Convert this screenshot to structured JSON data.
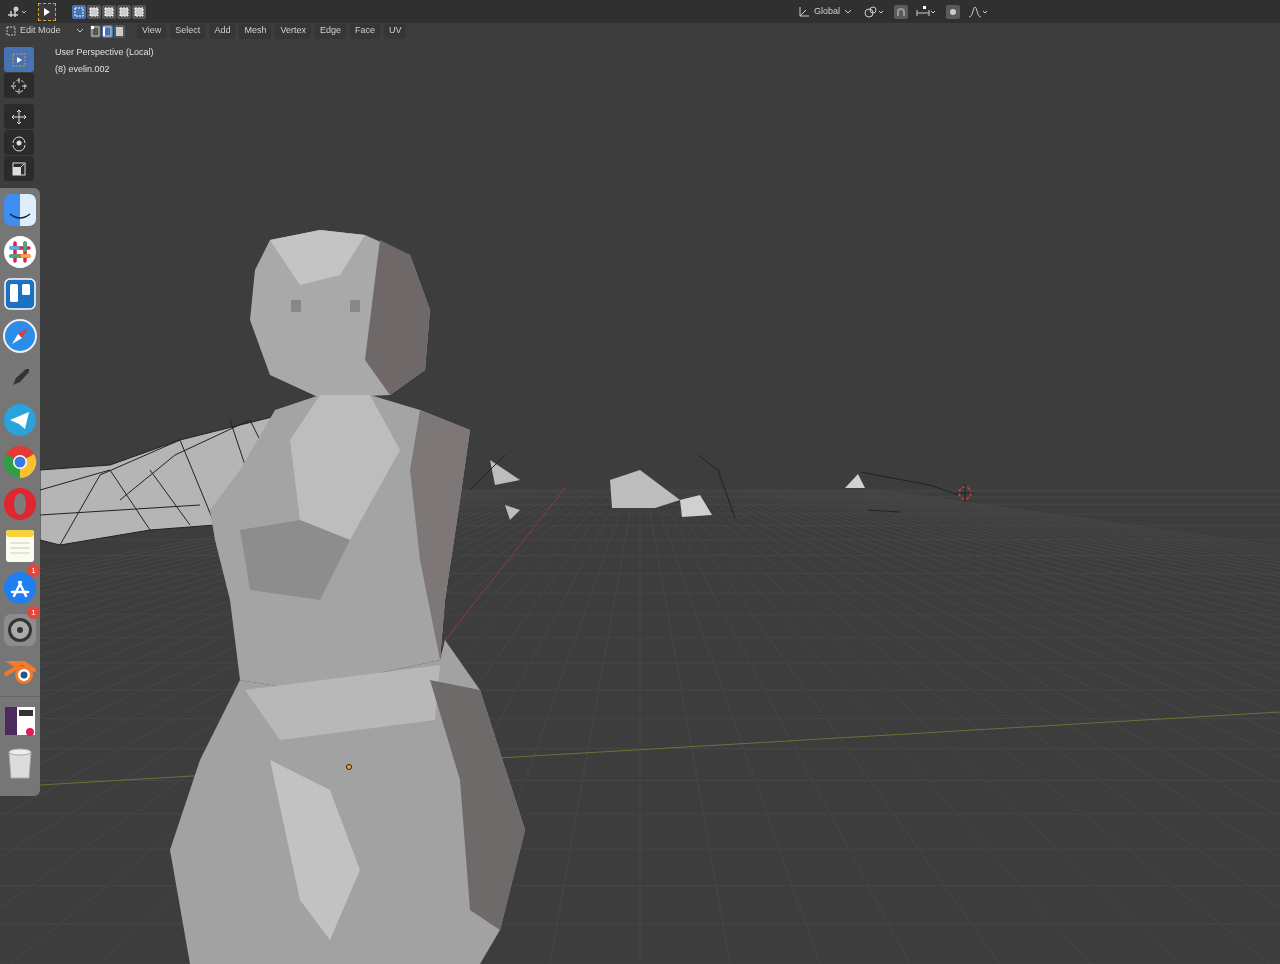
{
  "header": {
    "select_box_modes": [
      {
        "selected": true
      },
      {
        "selected": false
      },
      {
        "selected": false
      },
      {
        "selected": false
      },
      {
        "selected": false
      }
    ],
    "mode": "Edit Mode",
    "mesh_select_modes": [
      {
        "kind": "vertex",
        "selected": false
      },
      {
        "kind": "edge",
        "selected": true
      },
      {
        "kind": "face",
        "selected": false
      }
    ],
    "menus": [
      "View",
      "Select",
      "Add",
      "Mesh",
      "Vertex",
      "Edge",
      "Face",
      "UV"
    ],
    "orientation": "Global",
    "snap": {
      "on": true
    },
    "proportional_editing": {
      "on": true
    }
  },
  "tools": [
    {
      "kind": "select",
      "selected": true
    },
    {
      "kind": "cursor",
      "selected": false
    },
    {
      "kind": "move",
      "selected": false
    },
    {
      "kind": "rotate",
      "selected": false
    },
    {
      "kind": "scale",
      "selected": false
    }
  ],
  "viewport": {
    "view_name": "User Perspective (Local)",
    "object_name": "(8) evelin.002"
  },
  "dock": [
    {
      "kind": "finder"
    },
    {
      "kind": "slack"
    },
    {
      "kind": "trello"
    },
    {
      "kind": "safari"
    },
    {
      "kind": "launchpad"
    },
    {
      "kind": "telegram"
    },
    {
      "kind": "chrome"
    },
    {
      "kind": "opera"
    },
    {
      "kind": "notes"
    },
    {
      "kind": "appstore",
      "badge": "1"
    },
    {
      "kind": "settings",
      "badge": "1"
    },
    {
      "kind": "blender"
    },
    {
      "kind": "downloads"
    },
    {
      "kind": "trash"
    }
  ]
}
